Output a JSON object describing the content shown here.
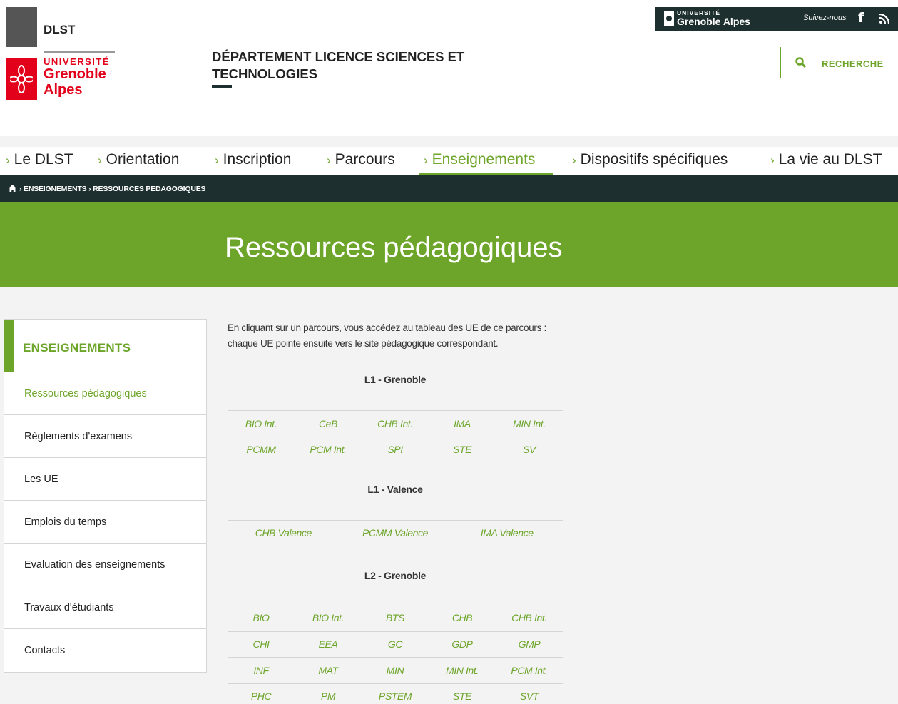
{
  "logo": {
    "dept": "DLST",
    "univ_small": "UNIVERSITÉ",
    "univ_name_1": "Grenoble",
    "univ_name_2": "Alpes"
  },
  "site_title": "DÉPARTEMENT LICENCE SCIENCES ET TECHNOLOGIES",
  "topbar": {
    "univ_small": "UNIVERSITÉ",
    "univ_name": "Grenoble Alpes",
    "follow": "Suivez-nous",
    "icons": [
      "facebook-icon",
      "rss-icon"
    ]
  },
  "search": {
    "label": "RECHERCHE",
    "icon": "search-icon"
  },
  "nav": [
    {
      "label": "Le DLST"
    },
    {
      "label": "Orientation"
    },
    {
      "label": "Inscription"
    },
    {
      "label": "Parcours"
    },
    {
      "label": "Enseignements",
      "active": true
    },
    {
      "label": "Dispositifs spécifiques"
    },
    {
      "label": "La vie au DLST"
    }
  ],
  "breadcrumb": {
    "items": [
      "ENSEIGNEMENTS",
      "RESSOURCES PÉDAGOGIQUES"
    ],
    "separator": "›",
    "home_icon": "home-icon"
  },
  "banner": {
    "title": "Ressources pédagogiques"
  },
  "sidebar": {
    "heading": "ENSEIGNEMENTS",
    "items": [
      {
        "label": "Ressources pédagogiques",
        "active": true
      },
      {
        "label": "Règlements d'examens"
      },
      {
        "label": "Les UE"
      },
      {
        "label": "Emplois du temps"
      },
      {
        "label": "Evaluation des enseignements"
      },
      {
        "label": "Travaux d'étudiants"
      },
      {
        "label": "Contacts"
      }
    ]
  },
  "content": {
    "intro_1": "En cliquant sur un parcours, vous accédez au tableau des UE de ce parcours :",
    "intro_2": "chaque UE pointe ensuite vers le site pédagogique correspondant.",
    "sections": [
      {
        "title": "L1 - Grenoble",
        "rows": [
          [
            "BIO Int.",
            "CeB",
            "CHB Int.",
            "IMA",
            "MIN Int."
          ],
          [
            "PCMM",
            "PCM Int.",
            "SPI",
            "STE",
            "SV"
          ]
        ]
      },
      {
        "title": "L1 - Valence",
        "rows": [
          [
            "CHB Valence",
            "PCMM Valence",
            "IMA Valence"
          ]
        ]
      },
      {
        "title": "L2 - Grenoble",
        "rows": [
          [
            "BIO",
            "BIO Int.",
            "BTS",
            "CHB",
            "CHB Int."
          ],
          [
            "CHI",
            "EEA",
            "GC",
            "GDP",
            "GMP"
          ],
          [
            "INF",
            "MAT",
            "MIN",
            "MIN Int.",
            "PCM Int."
          ],
          [
            "PHC",
            "PM",
            "PSTEM",
            "STE",
            "SVT"
          ]
        ]
      }
    ]
  },
  "colors": {
    "accent": "#6da52a",
    "dark": "#1e2f2f",
    "brand_red": "#e2001a",
    "background": "#f3f3f3"
  }
}
